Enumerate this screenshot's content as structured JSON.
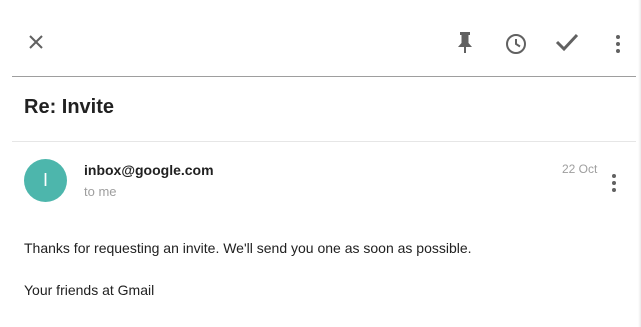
{
  "toolbar": {
    "icons": {
      "close": "close-icon",
      "pin": "pin-icon",
      "snooze": "clock-icon",
      "done": "check-icon",
      "more": "more-vert-icon"
    },
    "divider_color": "#9e9e9e"
  },
  "message": {
    "subject": "Re: Invite",
    "sender_email": "inbox@google.com",
    "recipient": "to me",
    "date": "22 Oct",
    "avatar_initial": "I",
    "avatar_color": "#4db6ac",
    "body_lines": [
      "Thanks for requesting an invite. We'll send you one as soon as possible.",
      "Your friends at Gmail"
    ]
  }
}
